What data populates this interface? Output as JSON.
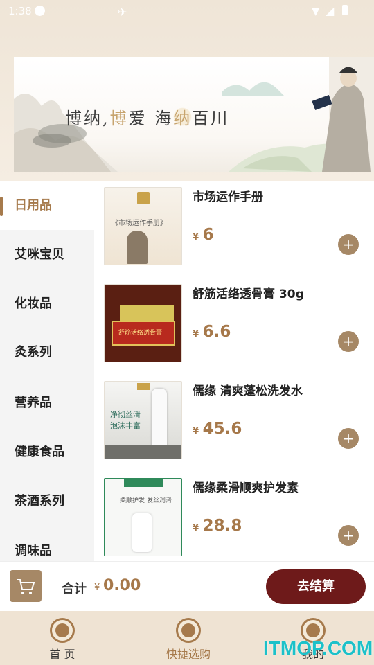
{
  "status_bar": {
    "time": "1:38"
  },
  "banner": {
    "slogan_parts": [
      "博纳,",
      "博",
      "爱 海",
      "纳",
      "百川"
    ]
  },
  "sidebar": {
    "categories": [
      "日用品",
      "艾咪宝贝",
      "化妆品",
      "灸系列",
      "营养品",
      "健康食品",
      "茶酒系列",
      "调味品"
    ],
    "active_index": 0
  },
  "products": [
    {
      "name": "市场运作手册",
      "currency": "¥",
      "price": "6",
      "thumb_text": "《市场运作手册》"
    },
    {
      "name": "舒筋活络透骨膏 30g",
      "currency": "¥",
      "price": "6.6",
      "thumb_text": "舒筋活络透骨膏"
    },
    {
      "name": "儒缘 清爽蓬松洗发水",
      "currency": "¥",
      "price": "45.6",
      "thumb_text": "净彻丝滑 泡沫丰富"
    },
    {
      "name": "儒缘柔滑顺爽护发素",
      "currency": "¥",
      "price": "28.8",
      "thumb_text": "柔顺护发 发丝润滑"
    }
  ],
  "cart": {
    "total_label": "合计",
    "currency": "¥",
    "total_value": "0.00",
    "checkout_label": "去结算"
  },
  "tabbar": {
    "tabs": [
      {
        "label": "首 页",
        "icon": "home-icon"
      },
      {
        "label": "快捷选购",
        "icon": "shopping-cart-icon"
      },
      {
        "label": "我的",
        "icon": "user-icon"
      }
    ],
    "active_index": 1
  },
  "watermark": "ITMOP.COM",
  "colors": {
    "accent": "#a67a4c",
    "checkout": "#6e1a1a",
    "price": "#a6784a",
    "tabbar": "#efe3d3"
  }
}
